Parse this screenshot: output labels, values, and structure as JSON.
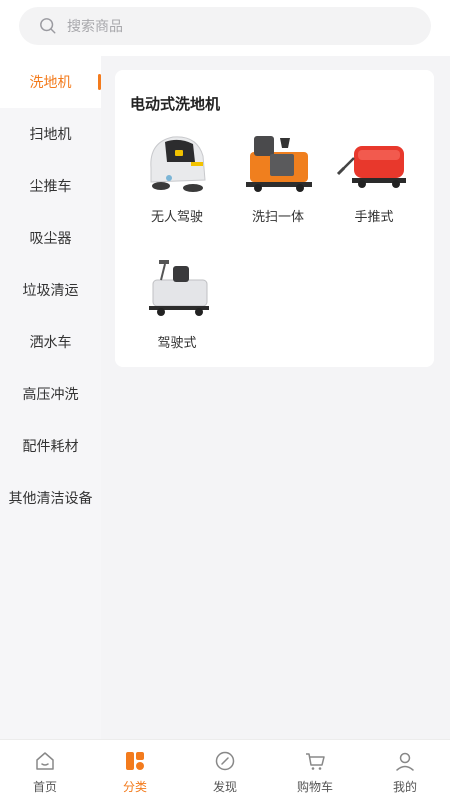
{
  "search": {
    "placeholder": "搜索商品",
    "icon": "search-icon"
  },
  "sidebar": {
    "active_color": "#f37b1d",
    "items": [
      {
        "label": "洗地机",
        "active": true
      },
      {
        "label": "扫地机"
      },
      {
        "label": "尘推车"
      },
      {
        "label": "吸尘器"
      },
      {
        "label": "垃圾清运"
      },
      {
        "label": "洒水车"
      },
      {
        "label": "高压冲洗"
      },
      {
        "label": "配件耗材"
      },
      {
        "label": "其他清洁设备"
      }
    ]
  },
  "content": {
    "section_title": "电动式洗地机",
    "products": [
      {
        "label": "无人驾驶",
        "image": "autonomous-scrubber-image"
      },
      {
        "label": "洗扫一体",
        "image": "sweeper-scrubber-image"
      },
      {
        "label": "手推式",
        "image": "walk-behind-scrubber-image"
      },
      {
        "label": "驾驶式",
        "image": "ride-on-scrubber-image"
      }
    ]
  },
  "tabbar": {
    "items": [
      {
        "label": "首页",
        "icon": "home-icon"
      },
      {
        "label": "分类",
        "icon": "category-icon",
        "active": true
      },
      {
        "label": "发现",
        "icon": "compass-icon"
      },
      {
        "label": "购物车",
        "icon": "cart-icon"
      },
      {
        "label": "我的",
        "icon": "user-icon"
      }
    ]
  }
}
